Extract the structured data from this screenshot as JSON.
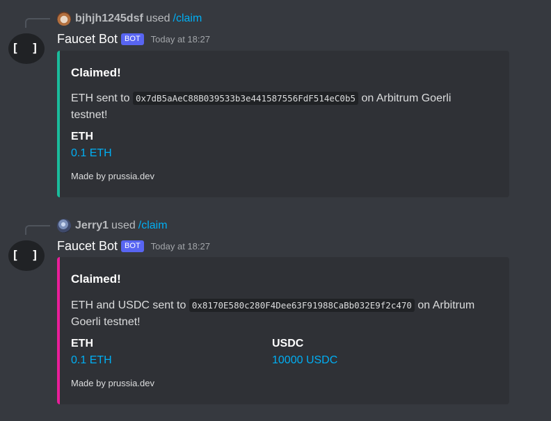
{
  "messages": [
    {
      "reply": {
        "user": "bjhjh1245dsf",
        "used_text": "used",
        "command": "/claim",
        "avatar_icon": "owl-avatar"
      },
      "bot": {
        "avatar_text": "[ ]",
        "name": "Faucet Bot",
        "tag": "BOT",
        "timestamp": "Today at 18:27"
      },
      "embed": {
        "accent_color": "#1abc9c",
        "title": "Claimed!",
        "desc_prefix": "ETH sent to",
        "address": "0x7dB5aAeC88B039533b3e441587556FdF514eC0b5",
        "desc_suffix_1": "on Arbitrum Goerli",
        "desc_suffix_2": "testnet!",
        "fields": [
          {
            "name": "ETH",
            "value": "0.1 ETH"
          }
        ],
        "footer": "Made by prussia.dev"
      }
    },
    {
      "reply": {
        "user": "Jerry1",
        "used_text": "used",
        "command": "/claim",
        "avatar_icon": "planet-avatar"
      },
      "bot": {
        "avatar_text": "[ ]",
        "name": "Faucet Bot",
        "tag": "BOT",
        "timestamp": "Today at 18:27"
      },
      "embed": {
        "accent_color": "#e91e9a",
        "title": "Claimed!",
        "desc_prefix": "ETH and USDC sent to",
        "address": "0x8170E580c280F4Dee63F91988CaBb032E9f2c470",
        "desc_suffix_1": "on Arbitrum",
        "desc_suffix_2": "Goerli testnet!",
        "fields": [
          {
            "name": "ETH",
            "value": "0.1 ETH"
          },
          {
            "name": "USDC",
            "value": "10000 USDC"
          }
        ],
        "footer": "Made by prussia.dev"
      }
    }
  ]
}
